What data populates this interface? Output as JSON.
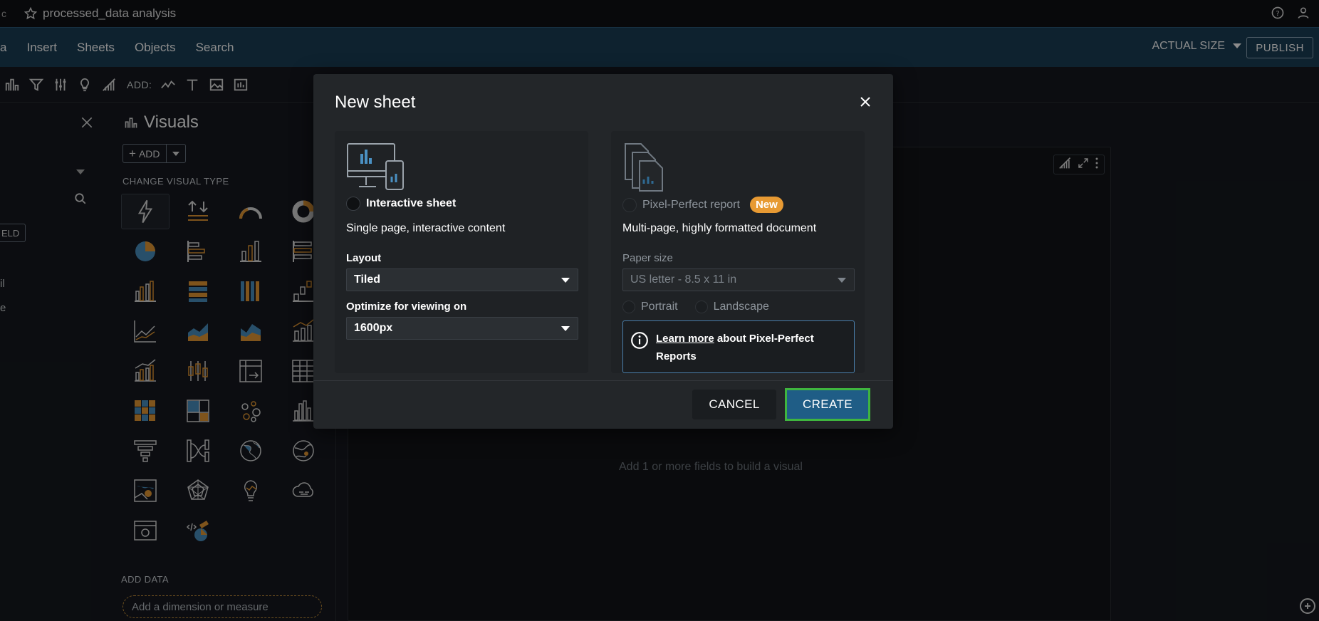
{
  "topbar": {
    "title": "processed_data analysis",
    "left_edge": "c"
  },
  "menubar": {
    "items": [
      "a",
      "Insert",
      "Sheets",
      "Objects",
      "Search"
    ],
    "actual_size": "ACTUAL SIZE",
    "publish": "PUBLISH"
  },
  "toolbar": {
    "add_label": "ADD:"
  },
  "leftpane": {
    "field_btn": "ELD",
    "item1": "il",
    "item2": "e"
  },
  "visuals": {
    "title": "Visuals",
    "add_label": "ADD",
    "change_type": "CHANGE VISUAL TYPE",
    "add_data": "ADD DATA",
    "dimension_placeholder": "Add a dimension or measure"
  },
  "canvas": {
    "hint": "Add 1 or more fields to build a visual"
  },
  "modal": {
    "title": "New sheet",
    "interactive": {
      "label": "Interactive sheet",
      "description": "Single page, interactive content",
      "layout_label": "Layout",
      "layout_value": "Tiled",
      "optimize_label": "Optimize for viewing on",
      "optimize_value": "1600px"
    },
    "pixel": {
      "label": "Pixel-Perfect report",
      "badge": "New",
      "description": "Multi-page, highly formatted document",
      "paper_label": "Paper size",
      "paper_value": "US letter - 8.5 x 11 in",
      "portrait": "Portrait",
      "landscape": "Landscape",
      "info_link": "Learn more",
      "info_text": "about Pixel-Perfect Reports"
    },
    "cancel": "CANCEL",
    "create": "CREATE"
  },
  "colors": {
    "accent": "#1f5d86",
    "badge": "#e79a33",
    "highlight": "#3fb53f",
    "menubar": "#1b3f57"
  }
}
